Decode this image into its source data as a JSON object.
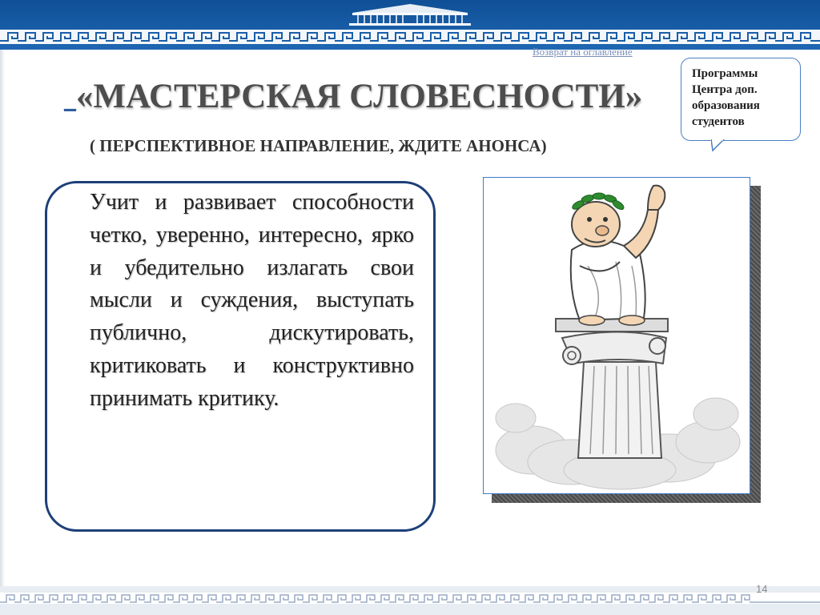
{
  "slide": {
    "back_link": "Возврат на  оглавление",
    "title_dash": "_",
    "title": "«МАСТЕРСКАЯ СЛОВЕСНОСТИ»",
    "subtitle": "( ПЕРСПЕКТИВНОЕ НАПРАВЛЕНИЕ, ЖДИТЕ АНОНСА)",
    "callout_lines": [
      "Программы",
      "Центра доп.",
      "образования",
      "студентов"
    ],
    "body_text": "Учит и развивает способности четко, уверенно, интересно, ярко и убедительно излагать свои мысли и суждения, выступать публично, дискутировать, критиковать и конструктивно принимать критику.",
    "page_number": "14"
  },
  "illustration": {
    "icon": "orator-on-column-icon"
  },
  "colors": {
    "header_blue": "#1a5ea8",
    "title_gray": "#4d4d4d",
    "box_border": "#1e3f78",
    "callout_border": "#4a7fc1"
  }
}
